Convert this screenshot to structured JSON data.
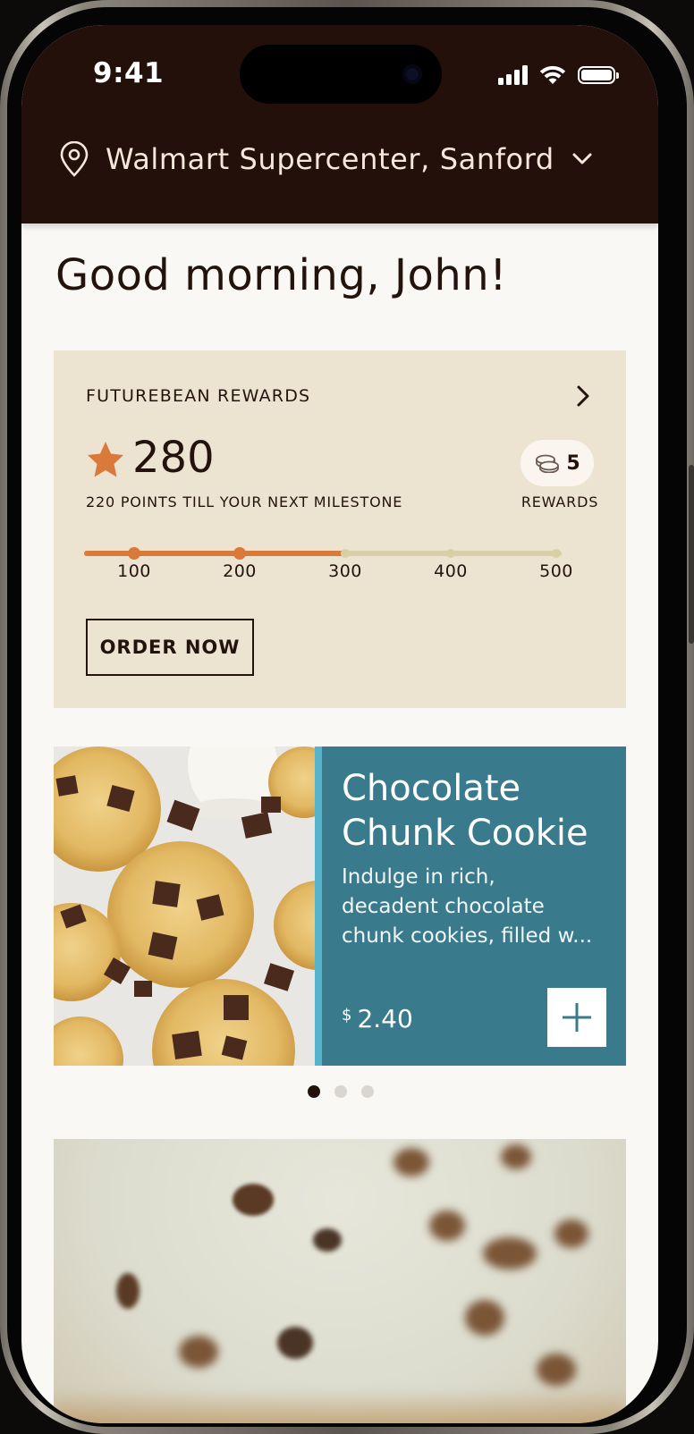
{
  "status_bar": {
    "time": "9:41"
  },
  "header": {
    "store_name": "Walmart Supercenter, Sanford"
  },
  "greeting": "Good morning, John!",
  "rewards": {
    "title": "FUTUREBEAN REWARDS",
    "points": "280",
    "points_note": "220 POINTS TILL YOUR NEXT MILESTONE",
    "rewards_count": "5",
    "rewards_label": "REWARDS",
    "progress_fraction": 0.55,
    "milestones": [
      "100",
      "200",
      "300",
      "400",
      "500"
    ],
    "order_button": "ORDER NOW"
  },
  "featured": {
    "name_line1": "Chocolate",
    "name_line2": "Chunk Cookie",
    "description_lines": [
      "Indulge in rich,",
      "decadent chocolate",
      "chunk cookies, filled w..."
    ],
    "currency": "$",
    "price": "2.40"
  },
  "colors": {
    "header_bg": "#23100a",
    "page_bg": "#faf8f4",
    "rewards_bg": "#ede3d1",
    "accent_orange": "#d9793a",
    "product_teal": "#397a8c",
    "text_dark": "#24130c"
  }
}
